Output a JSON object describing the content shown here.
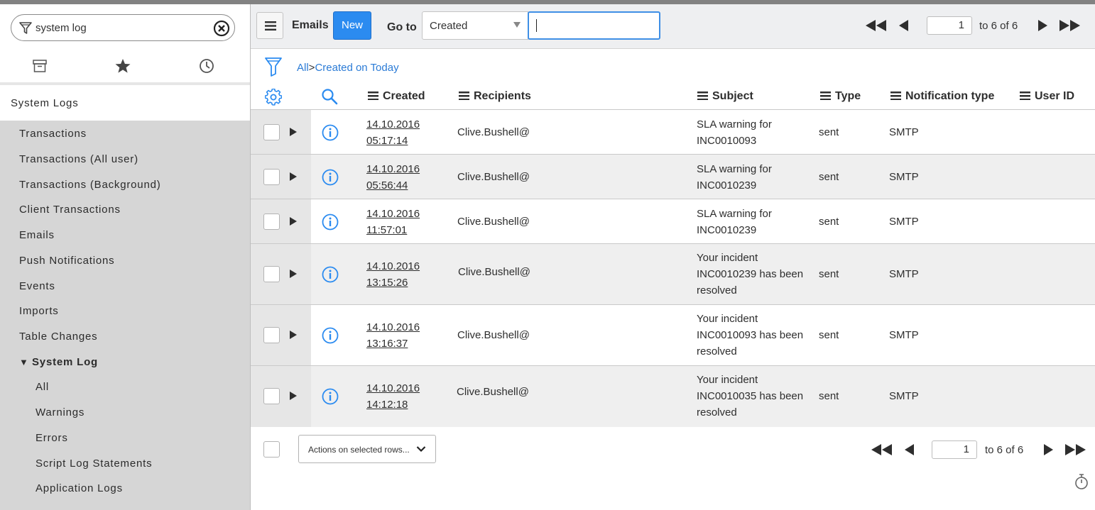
{
  "navigator": {
    "search_value": "system log",
    "tabs": [
      "archive-icon",
      "star-icon",
      "history-icon"
    ],
    "app_title": "System Logs",
    "items": [
      {
        "label": "Transactions",
        "level": 1
      },
      {
        "label": "Transactions (All user)",
        "level": 1
      },
      {
        "label": "Transactions (Background)",
        "level": 1
      },
      {
        "label": "Client Transactions",
        "level": 1
      },
      {
        "label": "Emails",
        "level": 1
      },
      {
        "label": "Push Notifications",
        "level": 1
      },
      {
        "label": "Events",
        "level": 1
      },
      {
        "label": "Imports",
        "level": 1
      },
      {
        "label": "Table Changes",
        "level": 1
      },
      {
        "label": "System Log",
        "level": 1,
        "expanded": true
      },
      {
        "label": "All",
        "level": 2
      },
      {
        "label": "Warnings",
        "level": 2
      },
      {
        "label": "Errors",
        "level": 2
      },
      {
        "label": "Script Log Statements",
        "level": 2
      },
      {
        "label": "Application Logs",
        "level": 2
      }
    ]
  },
  "toolbar": {
    "title": "Emails",
    "new_label": "New",
    "goto_label": "Go to",
    "goto_field": "Created",
    "goto_value": ""
  },
  "pager": {
    "page": "1",
    "range_text": "to 6 of 6"
  },
  "breadcrumb": {
    "all": "All",
    "separator": ">",
    "filter": "Created on Today"
  },
  "columns": {
    "created": "Created",
    "recipients": "Recipients",
    "subject": "Subject",
    "type": "Type",
    "notification_type": "Notification type",
    "user_id": "User ID"
  },
  "rows": [
    {
      "date": "14.10.2016",
      "time": "05:17:14",
      "recipient": "Clive.Bushell@",
      "subject": [
        "SLA warning for",
        "INC0010093"
      ],
      "type": "sent",
      "notification_type": "SMTP",
      "user_id": ""
    },
    {
      "date": "14.10.2016",
      "time": "05:56:44",
      "recipient": "Clive.Bushell@",
      "subject": [
        "SLA warning for",
        "INC0010239"
      ],
      "type": "sent",
      "notification_type": "SMTP",
      "user_id": ""
    },
    {
      "date": "14.10.2016",
      "time": "11:57:01",
      "recipient": "Clive.Bushell@",
      "subject": [
        "SLA warning for",
        "INC0010239"
      ],
      "type": "sent",
      "notification_type": "SMTP",
      "user_id": ""
    },
    {
      "date": "14.10.2016",
      "time": "13:15:26",
      "recipient": "Clive.Bushell@",
      "subject": [
        "Your incident",
        "INC0010239 has been",
        "resolved"
      ],
      "type": "sent",
      "notification_type": "SMTP",
      "user_id": ""
    },
    {
      "date": "14.10.2016",
      "time": "13:16:37",
      "recipient": "Clive.Bushell@",
      "subject": [
        "Your incident",
        "INC0010093 has been",
        "resolved"
      ],
      "type": "sent",
      "notification_type": "SMTP",
      "user_id": ""
    },
    {
      "date": "14.10.2016",
      "time": "14:12:18",
      "recipient": "Clive.Bushell@",
      "subject": [
        "Your incident",
        "INC0010035 has been",
        "resolved"
      ],
      "type": "sent",
      "notification_type": "SMTP",
      "user_id": ""
    }
  ],
  "footer": {
    "actions_label": "Actions on selected rows..."
  },
  "colors": {
    "accent": "#2b8bf0",
    "link": "#2b7bd6",
    "nav_background": "#d6d6d6"
  }
}
